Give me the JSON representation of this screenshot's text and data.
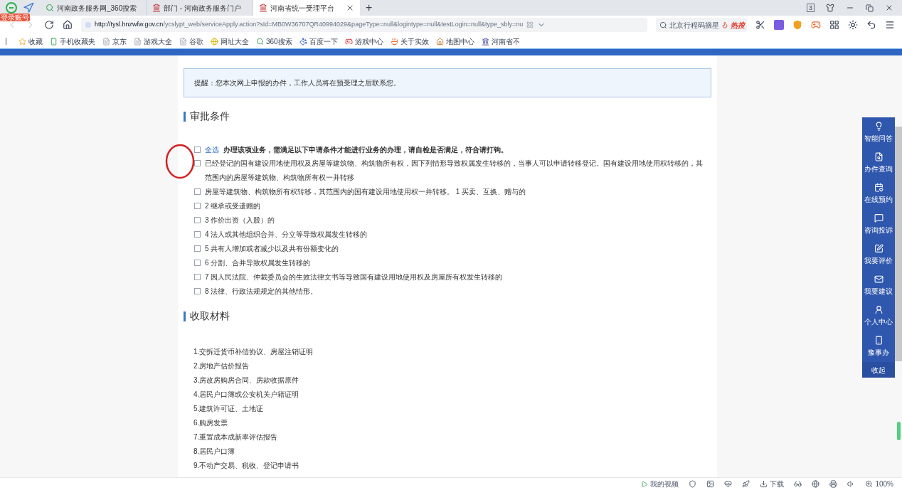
{
  "browser": {
    "login_badge": "登录账号",
    "tabs": [
      {
        "title": "河南政务服务网_360搜索",
        "selected": false
      },
      {
        "title": "部门 - 河南政务服务门户",
        "selected": false
      },
      {
        "title": "河南省统一受理平台",
        "selected": true
      }
    ],
    "new_tab": "+",
    "tab_count": "3",
    "url_domain": "http://tysl.hnzwfw.gov.cn",
    "url_path": "/ycslypt_web/serviceApply.action?sId=MB0W36707QR40994029&pageType=null&logintype=null&testLogin=null&type_sbly=nu",
    "search_value": "北京行程码摘星",
    "hot_label": "热搜",
    "bookmarks": [
      "收藏",
      "手机收藏夹",
      "京东",
      "游戏大全",
      "谷歌",
      "网址大全",
      "360搜索",
      "百度一下",
      "游戏中心",
      "关于实效",
      "地图中心",
      "河南省不"
    ]
  },
  "notice": "提醒：您本次网上申报的办件，工作人员将在预受理之后联系您。",
  "conditions": {
    "title": "审批条件",
    "select_all": "全选",
    "intro": "办理该项业务，需满足以下申请条件才能进行业务的办理，请自检是否满足，符合请打钩。",
    "intro_checked": false,
    "items": [
      {
        "text": "已经登记的国有建设用地使用权及房屋等建筑物、构筑物所有权，因下列情形导致权属发生转移的，当事人可以申请转移登记。国有建设用地使用权转移的，其范围内的房屋等建筑物、构筑物所有权一并转移",
        "checked": false
      },
      {
        "text": "房屋等建筑物、构筑物所有权转移，其范围内的国有建设用地使用权一并转移。 1 买卖、互换、赠与的",
        "checked": false
      },
      {
        "text": "2 继承或受遗赠的",
        "checked": false
      },
      {
        "text": "3 作价出资（入股）的",
        "checked": false
      },
      {
        "text": "4 法人或其他组织合并、分立等导致权属发生转移的",
        "checked": false
      },
      {
        "text": "5 共有人增加或者减少以及共有份额变化的",
        "checked": false
      },
      {
        "text": "6 分割、合并导致权属发生转移的",
        "checked": false
      },
      {
        "text": "7 因人民法院、仲裁委员会的生效法律文书等导致国有建设用地使用权及房屋所有权发生转移的",
        "checked": false
      },
      {
        "text": "8 法律、行政法规规定的其他情形。",
        "checked": false
      }
    ]
  },
  "materials": {
    "title": "收取材料",
    "items": [
      "1.交拆迁货币补偿协议、房屋注销证明",
      "2.房地产估价报告",
      "3.房改房购房合同、房款收据原件",
      "4.居民户口簿或公安机关户籍证明",
      "5.建筑许可证、土地证",
      "6.购房发票",
      "7.重置成本成新率评估报告",
      "8.居民户口簿",
      "9.不动产交易、税收、登记申请书"
    ]
  },
  "side_menu": {
    "items": [
      "智能问答",
      "办件查询",
      "在线预约",
      "咨询投诉",
      "我要评价",
      "我要建议",
      "个人中心",
      "豫事办"
    ],
    "collapse": "收起"
  },
  "status_bar": {
    "video": "我的视频",
    "download": "下载",
    "zoom": "100%"
  }
}
